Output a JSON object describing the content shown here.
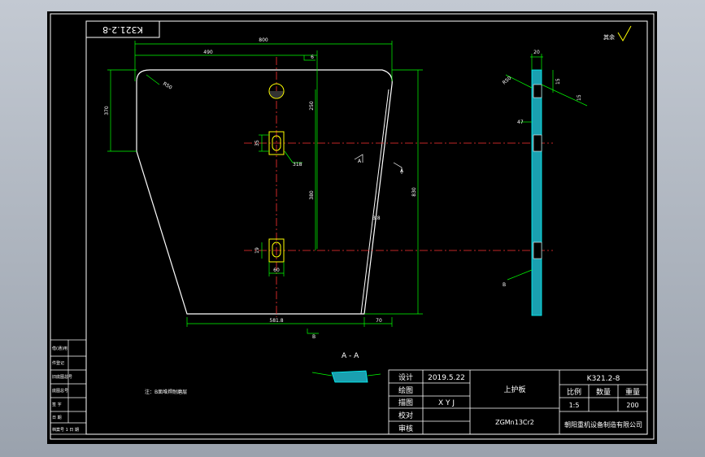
{
  "drawing": {
    "code_box": "K321.2-8",
    "roughness_label": "其余",
    "note": "注：B面堆焊耐磨层",
    "section_label": "A - A"
  },
  "dimensions": {
    "overall_width": "800",
    "top_width": "490",
    "top_right_step": "6",
    "corner_radius": "R50",
    "left_height": "370",
    "upper_pitch": "250",
    "slot_width": "35",
    "slot_center_label": "318",
    "lower_pitch": "380",
    "total_height": "830",
    "slot_height": "19",
    "slot_length": "60",
    "bottom_width": "581.8",
    "bottom_right": "70",
    "angle": "3.8",
    "section_mark_left": "A",
    "section_mark_right": "A",
    "side_thickness": "20",
    "side_chamfer": "R50",
    "side_dim1": "15",
    "side_dim2": "15",
    "side_small": "47",
    "face_label": "B",
    "bottom_mark": "B"
  },
  "title_block": {
    "row_labels": [
      "设计",
      "绘图",
      "描图",
      "校对",
      "审核"
    ],
    "design_date": "2019.5.22",
    "drawer_name": "",
    "tracer_name": "X Y J",
    "part_name": "上护板",
    "material": "ZGMn13Cr2",
    "drawing_no": "K321.2-8",
    "col_scale": "比例",
    "col_qty": "数量",
    "col_weight": "重量",
    "scale": "1:5",
    "qty": "",
    "weight": "200",
    "company": "朝阳重机设备制造有限公司"
  },
  "left_block": {
    "rows": [
      "借(通)用",
      "件登记",
      "旧底图总号",
      "底图总号",
      "签 字",
      "日 期",
      "档案号 1 日 期"
    ]
  },
  "colors": {
    "outline": "#ffffff",
    "dimension": "#00ff00",
    "centerline": "#ff0000",
    "hatch": "#00ffff",
    "slot": "#ffff00"
  }
}
